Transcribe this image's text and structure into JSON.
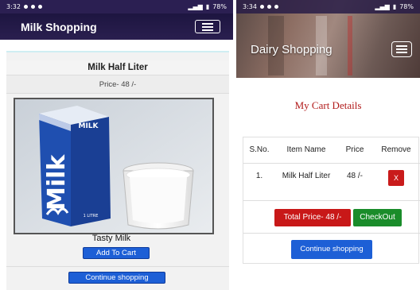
{
  "left": {
    "status": {
      "time": "3:32",
      "battery": "78%"
    },
    "navbar": {
      "brand": "Milk Shopping",
      "menu_icon": "hamburger-menu-icon"
    },
    "product": {
      "title": "Milk Half Liter",
      "price": "Price- 48 /-",
      "carton_text": "Milk",
      "carton_top_text": "MILK",
      "carton_size": "1 LITRE",
      "name": "Tasty Milk",
      "add_to_cart": "Add To Cart"
    },
    "continue_shopping": "Continue shopping"
  },
  "right": {
    "status": {
      "time": "3:34",
      "battery": "78%"
    },
    "navbar": {
      "brand": "Dairy Shopping",
      "menu_icon": "hamburger-menu-icon"
    },
    "cart": {
      "title": "My Cart Details",
      "headers": {
        "sno": "S.No.",
        "name": "Item Name",
        "price": "Price",
        "remove": "Remove"
      },
      "rows": [
        {
          "sno": "1.",
          "name": "Milk Half Liter",
          "price": "48 /-",
          "remove": "X"
        }
      ],
      "total": "Total Price- 48 /-",
      "checkout": "CheckOut",
      "continue_shopping": "Continue shopping"
    }
  },
  "colors": {
    "navbar": "#1d1540",
    "primary_button": "#1d5fd6",
    "danger_button": "#c81818",
    "success_button": "#1a8c2a",
    "cart_title": "#b11a1a"
  }
}
